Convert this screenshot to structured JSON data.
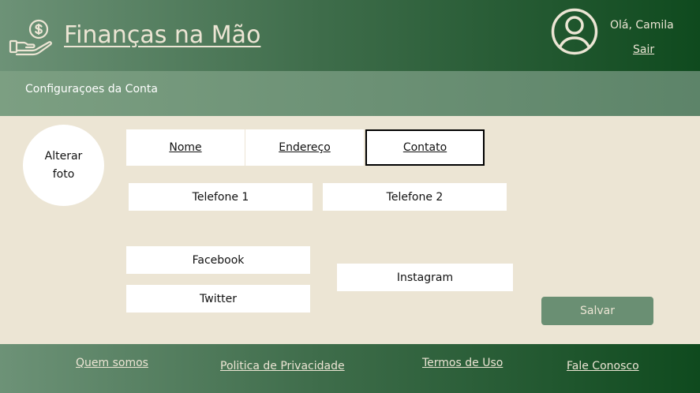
{
  "header": {
    "brand": "Finanças na Mão",
    "logo_icon": "hand-money-icon",
    "avatar_icon": "user-avatar-icon",
    "greeting": "Olá, Camila",
    "logout": "Sair"
  },
  "subheader": {
    "title": "Configuraçoes da Conta"
  },
  "profile": {
    "photo_label": "Alterar foto"
  },
  "tabs": [
    {
      "label": "Nome",
      "selected": false
    },
    {
      "label": "Endereço",
      "selected": false
    },
    {
      "label": "Contato",
      "selected": true
    }
  ],
  "fields": {
    "phone1": {
      "placeholder": "Telefone 1",
      "value": ""
    },
    "phone2": {
      "placeholder": "Telefone 2",
      "value": ""
    },
    "facebook": {
      "placeholder": "Facebook",
      "value": ""
    },
    "twitter": {
      "placeholder": "Twitter",
      "value": ""
    },
    "instagram": {
      "placeholder": "Instagram",
      "value": ""
    }
  },
  "actions": {
    "save": "Salvar"
  },
  "footer": {
    "links": [
      "Quem somos",
      "Politica de Privacidade",
      "Termos de Uso",
      "Fale Conosco"
    ]
  },
  "colors": {
    "background": "#ece5d4",
    "header_dark": "#0f4a1e",
    "header_light": "#6d9277",
    "button": "#6a8f73",
    "text_light": "#ece5d4"
  }
}
